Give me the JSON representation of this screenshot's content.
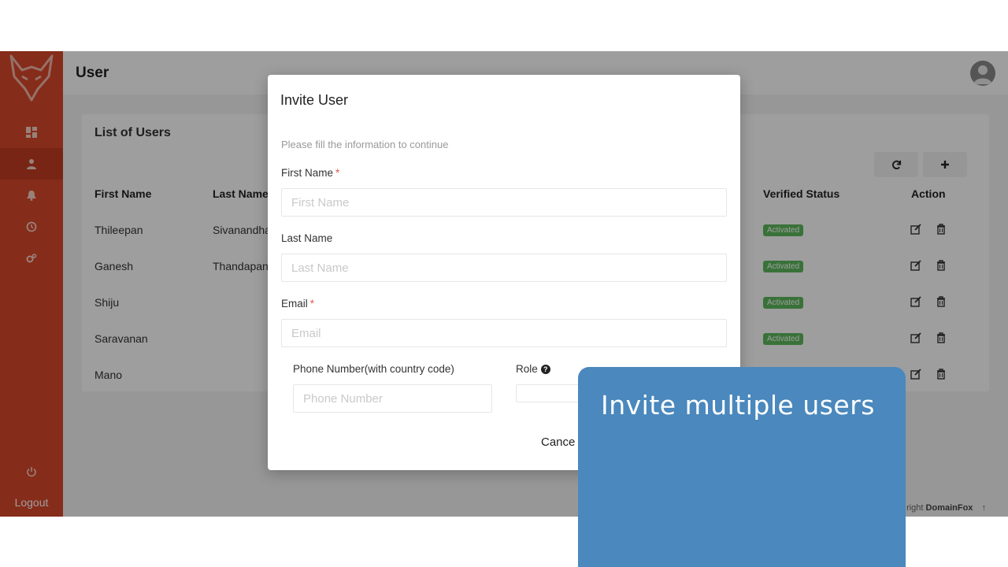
{
  "header": {
    "title": "User"
  },
  "sidebar": {
    "items": [
      {
        "icon": "dashboard-icon",
        "active": false
      },
      {
        "icon": "user-icon",
        "active": true
      },
      {
        "icon": "bell-icon",
        "active": false
      },
      {
        "icon": "clock-icon",
        "active": false
      },
      {
        "icon": "settings-icon",
        "active": false
      }
    ],
    "logout_label": "Logout"
  },
  "users_card": {
    "title": "List of Users",
    "refresh_icon": "refresh-icon",
    "add_icon": "plus-icon",
    "columns": {
      "first_name": "First Name",
      "last_name": "Last Name",
      "verified_status": "Verified Status",
      "action": "Action"
    },
    "rows": [
      {
        "first_name": "Thileepan",
        "last_name": "Sivanandha",
        "status": "Activated"
      },
      {
        "first_name": "Ganesh",
        "last_name": "Thandapani",
        "status": "Activated"
      },
      {
        "first_name": "Shiju",
        "last_name": "",
        "status": "Activated"
      },
      {
        "first_name": "Saravanan",
        "last_name": "",
        "status": "Activated"
      },
      {
        "first_name": "Mano",
        "last_name": "",
        "status": ""
      }
    ]
  },
  "footer": {
    "prefix": "right",
    "brand": "DomainFox",
    "arrow": "↑"
  },
  "modal": {
    "title": "Invite User",
    "subtitle": "Please fill the information to continue",
    "first_name_label": "First Name",
    "first_name_placeholder": "First Name",
    "last_name_label": "Last Name",
    "last_name_placeholder": "Last Name",
    "email_label": "Email",
    "email_placeholder": "Email",
    "phone_label": "Phone Number(with country code)",
    "phone_placeholder": "Phone Number",
    "role_label": "Role",
    "required_mark": "*",
    "cancel_label": "Cance"
  },
  "promo": {
    "text": "Invite multiple users"
  },
  "colors": {
    "sidebar": "#d9472b",
    "accent_badge": "#5cb85c",
    "promo": "#4a88bd"
  }
}
